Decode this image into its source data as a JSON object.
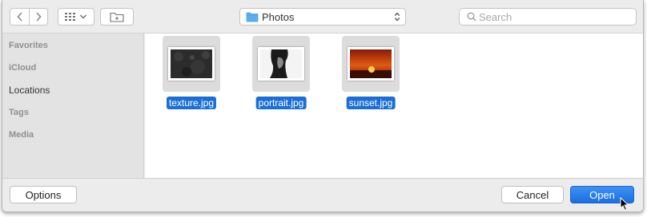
{
  "toolbar": {
    "back_icon": "chevron-left-icon",
    "forward_icon": "chevron-right-icon",
    "view_icon": "icon-grid-icon",
    "new_folder_icon": "new-folder-icon",
    "location": "Photos",
    "search_placeholder": "Search"
  },
  "sidebar": {
    "items": [
      {
        "label": "Favorites"
      },
      {
        "label": "iCloud"
      },
      {
        "label": "Locations"
      },
      {
        "label": "Tags"
      },
      {
        "label": "Media"
      }
    ]
  },
  "files": [
    {
      "name": "texture.jpg",
      "selected": true
    },
    {
      "name": "portrait.jpg",
      "selected": true
    },
    {
      "name": "sunset.jpg",
      "selected": true
    }
  ],
  "buttons": {
    "options": "Options",
    "cancel": "Cancel",
    "open": "Open"
  },
  "colors": {
    "selection": "#1a6fd6",
    "primary_button": "#1a6fe0",
    "folder_icon": "#5aaef0"
  }
}
